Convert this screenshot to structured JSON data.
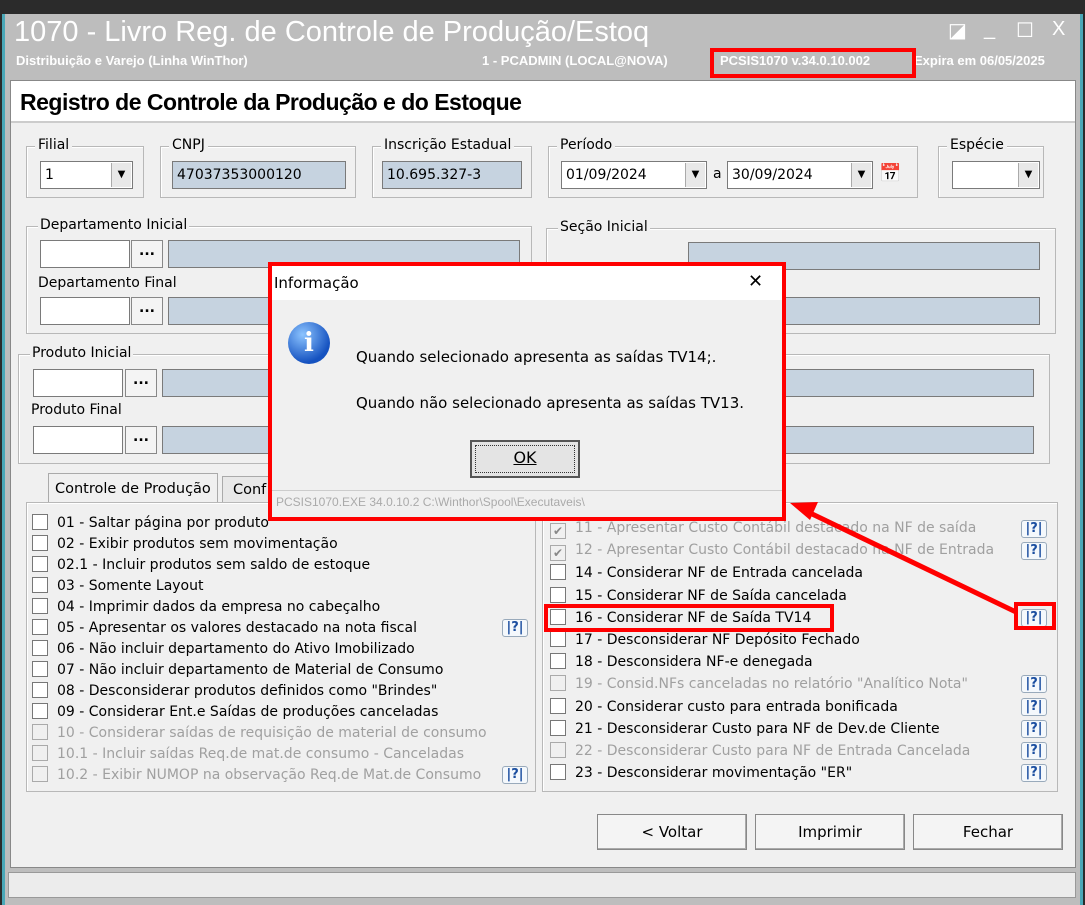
{
  "window": {
    "title": "1070 - Livro Reg. de Controle de Produção/Estoq",
    "subtitle": "Distribuição e Varejo (Linha WinThor)",
    "user": "1 - PCADMIN (LOCAL@NOVA)",
    "version": "PCSIS1070  v.34.0.10.002",
    "expires": "Expira em 06/05/2025"
  },
  "header": {
    "title": "Registro de Controle da Produção e do Estoque"
  },
  "filters": {
    "filial_label": "Filial",
    "filial": "1",
    "cnpj_label": "CNPJ",
    "cnpj": "47037353000120",
    "ie_label": "Inscrição Estadual",
    "ie": "10.695.327-3",
    "periodo_label": "Período",
    "data_ini": "01/09/2024",
    "sep": "a",
    "data_fim": "30/09/2024",
    "especie_label": "Espécie",
    "especie": "",
    "dep_ini": "Departamento Inicial",
    "dep_fim": "Departamento Final",
    "secao_ini": "Seção Inicial",
    "prod_ini": "Produto Inicial",
    "prod_fim": "Produto Final",
    "ellipsis": "..."
  },
  "tabs": [
    {
      "label": "Controle de Produção"
    },
    {
      "label": "Conf"
    }
  ],
  "left_options": [
    {
      "label": "01 - Saltar página por produto",
      "enabled": true
    },
    {
      "label": "02 - Exibir produtos sem movimentação",
      "enabled": true
    },
    {
      "label": "02.1 - Incluir produtos sem saldo de estoque",
      "enabled": true
    },
    {
      "label": "03 - Somente Layout",
      "enabled": true
    },
    {
      "label": "04 - Imprimir dados da empresa no cabeçalho",
      "enabled": true
    },
    {
      "label": "05 - Apresentar os valores destacado na nota fiscal",
      "enabled": true,
      "help": true
    },
    {
      "label": "06 - Não incluir departamento do Ativo Imobilizado",
      "enabled": true
    },
    {
      "label": "07 - Não incluir departamento de Material de Consumo",
      "enabled": true
    },
    {
      "label": "08 - Desconsiderar produtos definidos como \"Brindes\"",
      "enabled": true
    },
    {
      "label": "09 - Considerar Ent.e Saídas de produções canceladas",
      "enabled": true
    },
    {
      "label": "10 - Considerar saídas de requisição de material de consumo",
      "enabled": false
    },
    {
      "label": "10.1 - Incluir saídas Req.de mat.de consumo - Canceladas",
      "enabled": false
    },
    {
      "label": "10.2 - Exibir NUMOP na observação Req.de Mat.de Consumo",
      "enabled": false,
      "help": true
    }
  ],
  "right_options": [
    {
      "label": "11 - Apresentar Custo Contábil destacado na NF de saída",
      "enabled": false,
      "checked": true,
      "help": true
    },
    {
      "label": "12 - Apresentar Custo Contábil destacado na NF de Entrada",
      "enabled": false,
      "checked": true,
      "help": true
    },
    {
      "label": "14 - Considerar NF de Entrada cancelada",
      "enabled": true
    },
    {
      "label": "15 - Considerar NF de Saída cancelada",
      "enabled": true
    },
    {
      "label": "16 - Considerar NF de Saída TV14",
      "enabled": true,
      "help": true
    },
    {
      "label": "17 - Desconsiderar NF Depósito Fechado",
      "enabled": true
    },
    {
      "label": "18 - Desconsidera NF-e denegada",
      "enabled": true
    },
    {
      "label": "19 - Consid.NFs canceladas no relatório \"Analítico Nota\"",
      "enabled": false,
      "help": true
    },
    {
      "label": "20 - Considerar custo para entrada bonificada",
      "enabled": true,
      "help": true
    },
    {
      "label": "21 - Desconsiderar Custo para NF de Dev.de Cliente",
      "enabled": true,
      "help": true
    },
    {
      "label": "22 - Desconsiderar Custo para NF de Entrada Cancelada",
      "enabled": false,
      "help": true
    },
    {
      "label": "23 - Desconsiderar movimentação \"ER\"",
      "enabled": true,
      "help": true
    }
  ],
  "help_label": "|?|",
  "buttons": {
    "voltar": "< Voltar",
    "imprimir": "Imprimir",
    "fechar": "Fechar"
  },
  "dialog": {
    "title": "Informação",
    "close": "✕",
    "line1": "Quando selecionado apresenta as saídas TV14;.",
    "line2": "Quando não selecionado apresenta as saídas TV13.",
    "ok": "OK",
    "footer": "PCSIS1070.EXE 34.0.10.2 C:\\Winthor\\Spool\\Executaveis\\",
    "icon": "info-icon"
  },
  "colors": {
    "highlight": "#ff0000",
    "readonly": "#c6d3e0"
  }
}
